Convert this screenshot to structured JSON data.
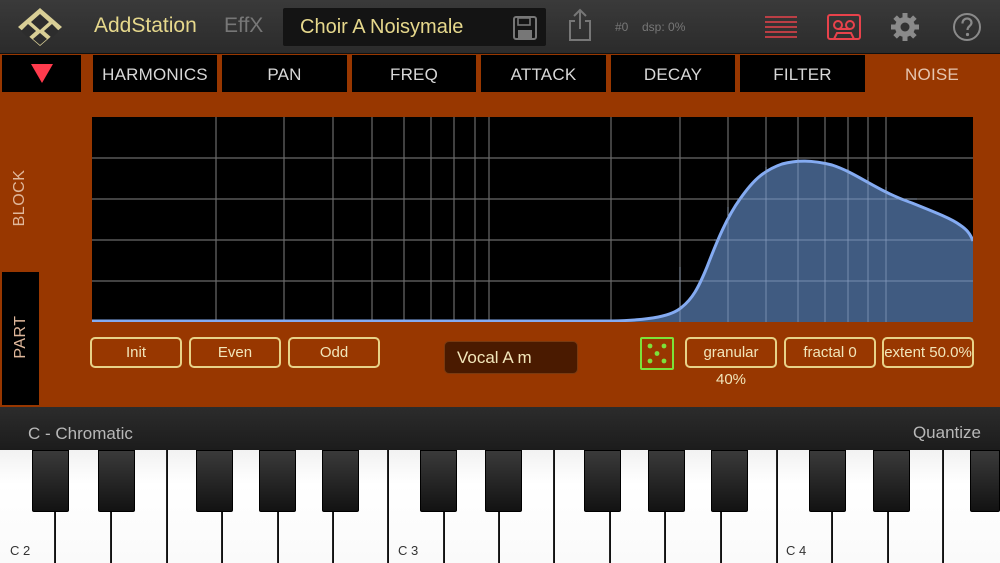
{
  "topbar": {
    "app_title": "AddStation",
    "effx_label": "EffX",
    "preset_name": "Choir A Noisymale",
    "patch_number": "#0",
    "dsp_load": "dsp: 0%",
    "icons": [
      "logo-icon",
      "save-icon",
      "share-icon",
      "menu-icon",
      "tape-icon",
      "gear-icon",
      "help-icon"
    ]
  },
  "tabs": [
    {
      "label": "HARMONICS",
      "active": false
    },
    {
      "label": "PAN",
      "active": false
    },
    {
      "label": "FREQ",
      "active": false
    },
    {
      "label": "ATTACK",
      "active": false
    },
    {
      "label": "DECAY",
      "active": false
    },
    {
      "label": "FILTER",
      "active": false
    },
    {
      "label": "NOISE",
      "active": true
    }
  ],
  "side_tabs": {
    "block": "BLOCK",
    "part": "PART"
  },
  "controls": {
    "init": "Init",
    "even": "Even",
    "odd": "Odd",
    "spectrum_preset": "Vocal A m",
    "granular": "granular 40%",
    "fractal": "fractal 0",
    "extent": "extent 50.0%"
  },
  "keyboard": {
    "scale": "C - Chromatic",
    "quantize": "Quantize",
    "octave_labels": [
      "C 2",
      "C 3",
      "C 4"
    ]
  },
  "colors": {
    "panel": "#983700",
    "accent_text": "#e6d88c",
    "curve": "#7fa7ef",
    "dice": "#7ce23a"
  }
}
